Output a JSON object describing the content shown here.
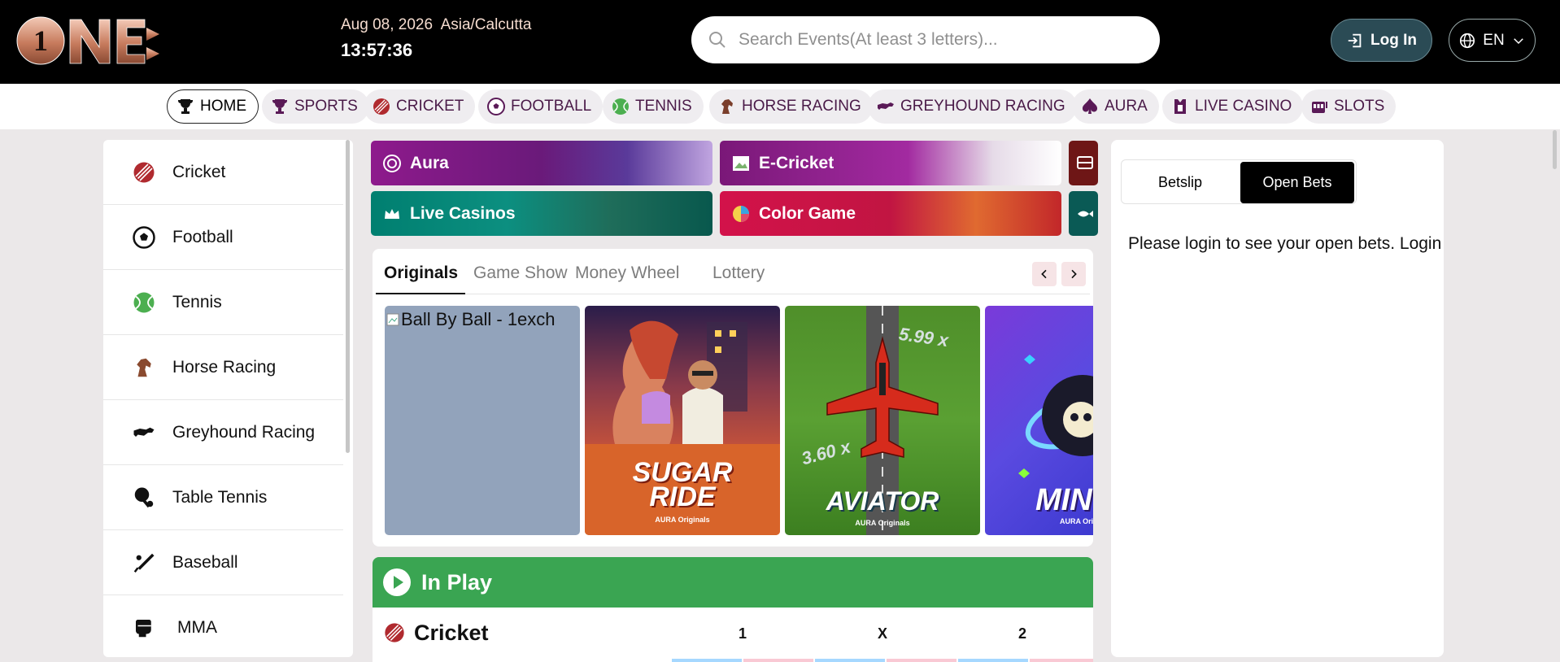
{
  "header": {
    "logo_text": "1NE",
    "date": "Aug 08, 2026",
    "timezone": "Asia/Calcutta",
    "time": "13:57:36",
    "search_placeholder": "Search Events(At least 3 letters)...",
    "login_label": "Log In",
    "lang_label": "EN"
  },
  "nav": [
    {
      "label": "HOME",
      "icon": "trophy-icon",
      "active": true
    },
    {
      "label": "SPORTS",
      "icon": "trophy-icon"
    },
    {
      "label": "CRICKET",
      "icon": "cricket-ball-icon"
    },
    {
      "label": "FOOTBALL",
      "icon": "football-icon"
    },
    {
      "label": "TENNIS",
      "icon": "tennis-ball-icon"
    },
    {
      "label": "HORSE RACING",
      "icon": "horse-icon"
    },
    {
      "label": "GREYHOUND RACING",
      "icon": "greyhound-icon"
    },
    {
      "label": "AURA",
      "icon": "spade-icon"
    },
    {
      "label": "LIVE CASINO",
      "icon": "card-icon"
    },
    {
      "label": "SLOTS",
      "icon": "slot-machine-icon"
    }
  ],
  "sidebar": {
    "items": [
      {
        "label": "Cricket",
        "icon": "cricket-ball-icon"
      },
      {
        "label": "Football",
        "icon": "football-icon"
      },
      {
        "label": "Tennis",
        "icon": "tennis-ball-icon"
      },
      {
        "label": "Horse Racing",
        "icon": "horse-icon"
      },
      {
        "label": "Greyhound Racing",
        "icon": "greyhound-icon"
      },
      {
        "label": "Table Tennis",
        "icon": "table-tennis-icon"
      },
      {
        "label": "Baseball",
        "icon": "baseball-bat-icon"
      },
      {
        "label": "MMA",
        "icon": "glove-icon"
      }
    ]
  },
  "banners": [
    {
      "label": "Aura",
      "icon": "chip-icon"
    },
    {
      "label": "E-Cricket",
      "icon": "image-icon"
    },
    {
      "label": "Live Casinos",
      "icon": "crown-icon"
    },
    {
      "label": "Color Game",
      "icon": "color-wheel-icon"
    }
  ],
  "games": {
    "tabs": [
      "Originals",
      "Game Show",
      "Money Wheel",
      "Lottery"
    ],
    "active_tab": "Originals",
    "tiles": [
      {
        "alt": "Ball By Ball - 1exch",
        "broken": true
      },
      {
        "title_line1": "SUGAR",
        "title_line2": "RIDE",
        "caption": "AURA Originals"
      },
      {
        "title_line1": "AVIATOR",
        "caption": "AURA Originals",
        "multiplier_a": "5.99 x",
        "multiplier_b": "3.60 x"
      },
      {
        "title_line1": "MIN",
        "caption": "AURA Origi"
      }
    ]
  },
  "inplay": {
    "title": "In Play",
    "sport": "Cricket",
    "cols": [
      "1",
      "X",
      "2"
    ]
  },
  "betslip": {
    "tabs": [
      "Betslip",
      "Open Bets"
    ],
    "active_tab": "Open Bets",
    "message": "Please login to see your open bets. Login"
  },
  "colors": {
    "header_bg": "#000000",
    "nav_text": "#4a1a48",
    "inplay_green": "#3aa552",
    "login_bg": "#2b4b55"
  }
}
